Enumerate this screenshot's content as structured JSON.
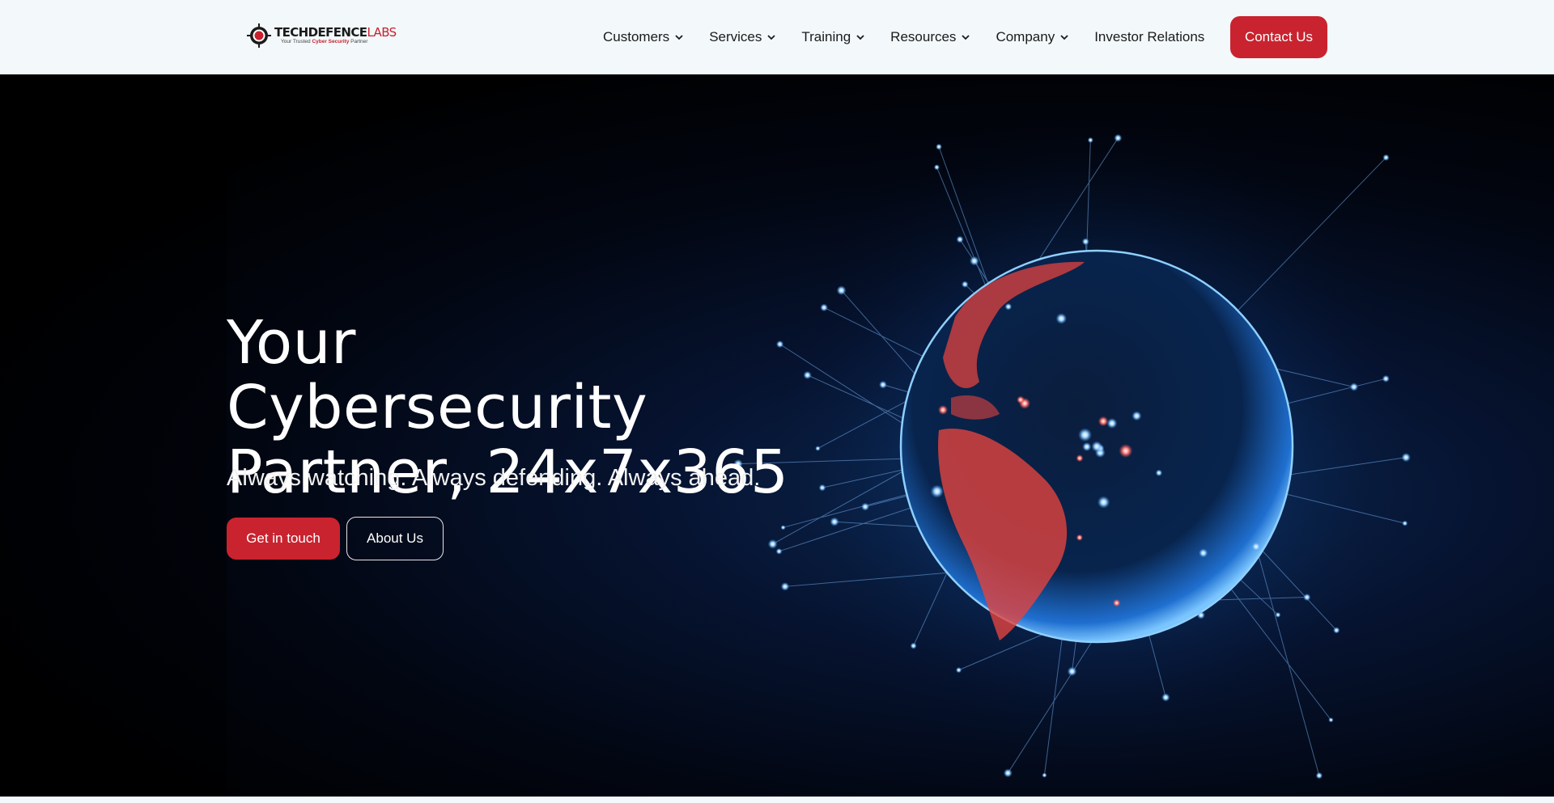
{
  "brand": {
    "name_prefix": "TECHDEFENCE",
    "name_suffix": "LABS",
    "tagline_a": "Your Trusted ",
    "tagline_b": "Cyber Security",
    "tagline_c": " Partner",
    "logo_icon": "crosshair-target-icon"
  },
  "nav": {
    "items": [
      {
        "label": "Customers",
        "has_dropdown": true
      },
      {
        "label": "Services",
        "has_dropdown": true
      },
      {
        "label": "Training",
        "has_dropdown": true
      },
      {
        "label": "Resources",
        "has_dropdown": true
      },
      {
        "label": "Company",
        "has_dropdown": true
      },
      {
        "label": "Investor Relations",
        "has_dropdown": false
      }
    ],
    "contact_label": "Contact Us",
    "dropdown_icon": "chevron-down-icon"
  },
  "hero": {
    "title_line1": "Your Cybersecurity",
    "title_line2": "Partner, 24x7x365",
    "subtitle": "Always watching. Always defending. Always ahead.",
    "primary_cta": "Get in touch",
    "secondary_cta": "About Us",
    "image": "glowing-network-globe-illustration"
  },
  "colors": {
    "accent": "#c9232f",
    "header_bg": "#f3f8fa",
    "hero_bg": "#020611",
    "globe_glow": "#3a8fe0",
    "land_glow": "#ff5a55"
  }
}
